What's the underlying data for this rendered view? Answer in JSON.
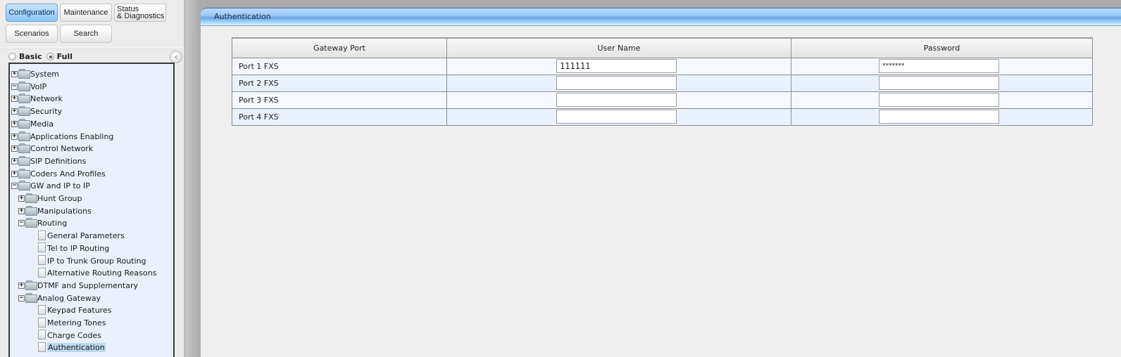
{
  "nav": {
    "buttons": [
      {
        "id": "configuration",
        "label": "Configuration",
        "active": true
      },
      {
        "id": "maintenance",
        "label": "Maintenance",
        "active": false
      },
      {
        "id": "status",
        "label_line1": "Status",
        "label_line2": "& Diagnostics",
        "active": false
      },
      {
        "id": "scenarios",
        "label": "Scenarios",
        "active": false
      },
      {
        "id": "search",
        "label": "Search",
        "active": false
      }
    ]
  },
  "mode": {
    "options": [
      {
        "label": "Basic",
        "checked": false
      },
      {
        "label": "Full",
        "checked": true
      }
    ],
    "collapse_icon": "chevron-left-icon"
  },
  "tree": {
    "items": [
      {
        "label": "System",
        "type": "folder",
        "expander": "+"
      },
      {
        "label": "VoIP",
        "type": "folder",
        "expander": "-"
      },
      {
        "label": "Network",
        "type": "folder",
        "expander": "+"
      },
      {
        "label": "Security",
        "type": "folder",
        "expander": "+"
      },
      {
        "label": "Media",
        "type": "folder",
        "expander": "+"
      },
      {
        "label": "Applications Enabling",
        "type": "folder",
        "expander": "+"
      },
      {
        "label": "Control Network",
        "type": "folder",
        "expander": "+"
      },
      {
        "label": "SIP Definitions",
        "type": "folder",
        "expander": "+"
      },
      {
        "label": "Coders And Profiles",
        "type": "folder",
        "expander": "+"
      },
      {
        "label": "GW and IP to IP",
        "type": "folder",
        "expander": "-"
      },
      {
        "label": "Hunt Group",
        "type": "folder",
        "expander": "+"
      },
      {
        "label": "Manipulations",
        "type": "folder",
        "expander": "+"
      },
      {
        "label": "Routing",
        "type": "folder",
        "expander": "-"
      },
      {
        "label": "General Parameters",
        "type": "page"
      },
      {
        "label": "Tel to IP Routing",
        "type": "page"
      },
      {
        "label": "IP to Trunk Group Routing",
        "type": "page"
      },
      {
        "label": "Alternative Routing Reasons",
        "type": "page"
      },
      {
        "label": "DTMF and Supplementary",
        "type": "folder",
        "expander": "+"
      },
      {
        "label": "Analog Gateway",
        "type": "folder",
        "expander": "-"
      },
      {
        "label": "Keypad Features",
        "type": "page"
      },
      {
        "label": "Metering Tones",
        "type": "page"
      },
      {
        "label": "Charge Codes",
        "type": "page"
      },
      {
        "label": "Authentication",
        "type": "page",
        "selected": true
      }
    ]
  },
  "page": {
    "title": "Authentication",
    "table": {
      "headers": [
        "Gateway Port",
        "User Name",
        "Password"
      ],
      "rows": [
        {
          "port": "Port 1  FXS",
          "user_name": "111111",
          "password": "*******"
        },
        {
          "port": "Port 2  FXS",
          "user_name": "",
          "password": ""
        },
        {
          "port": "Port 3  FXS",
          "user_name": "",
          "password": ""
        },
        {
          "port": "Port 4  FXS",
          "user_name": "",
          "password": ""
        }
      ]
    }
  },
  "colors": {
    "accent": "#a6d3fb",
    "tree_background": "#eaf1fc",
    "selected_item": "#bcd7f0"
  }
}
